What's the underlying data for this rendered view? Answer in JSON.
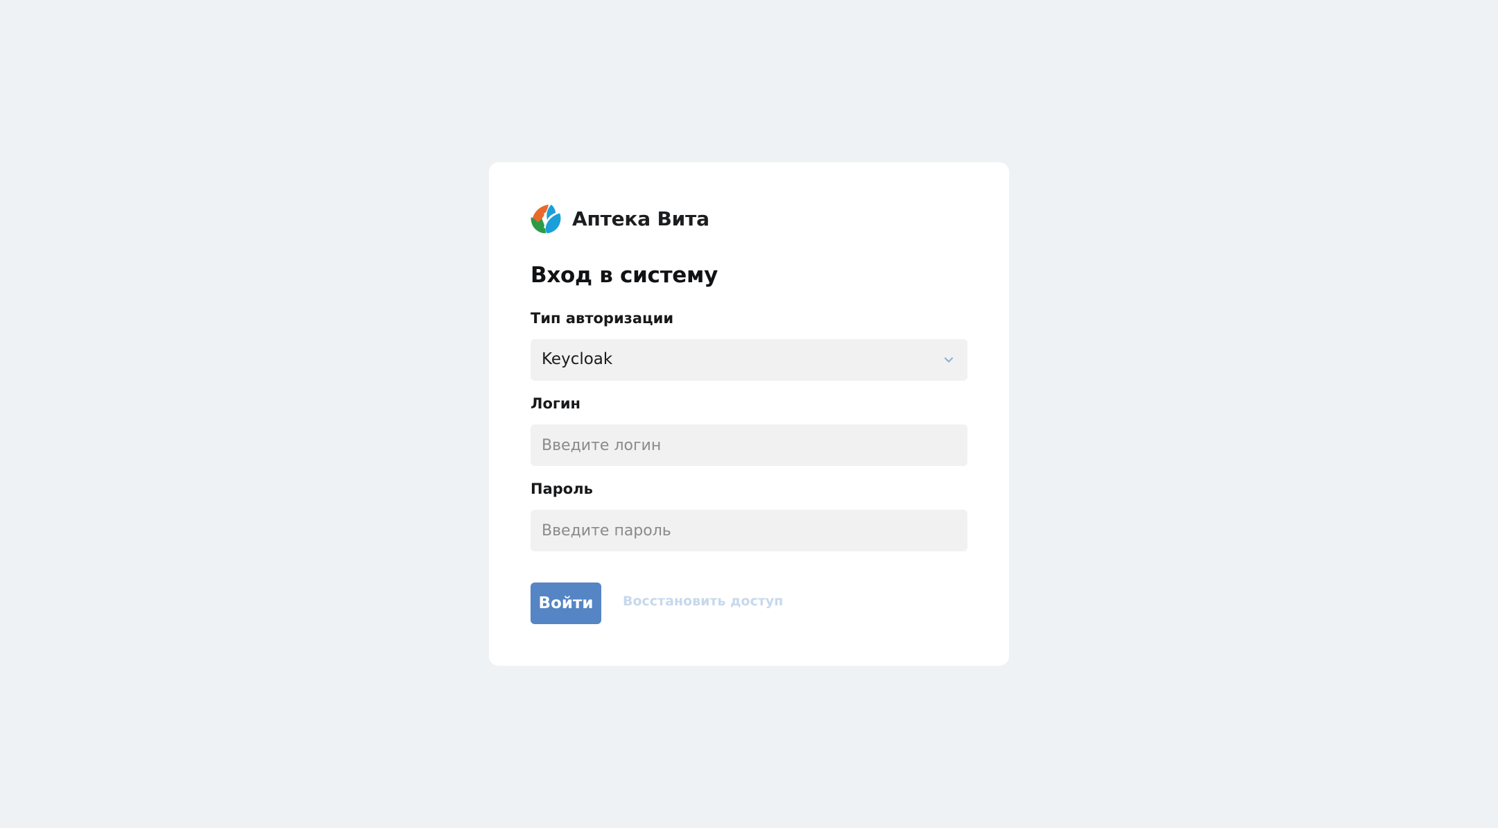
{
  "brand": {
    "name": "Аптека Вита",
    "logo_icon": "leaf-globe-logo",
    "logo_colors": [
      "#e8692c",
      "#2e9a48",
      "#1b9fd9"
    ]
  },
  "login_form": {
    "title": "Вход в систему",
    "auth_type": {
      "label": "Тип авторизации",
      "selected_value": "Keycloak",
      "icon": "chevron-down-icon"
    },
    "login": {
      "label": "Логин",
      "value": "",
      "placeholder": "Введите логин"
    },
    "password": {
      "label": "Пароль",
      "value": "",
      "placeholder": "Введите пароль"
    },
    "submit_label": "Войти",
    "restore_label": "Восстановить доступ"
  },
  "colors": {
    "page_background": "#eff2f5",
    "card_background": "#ffffff",
    "field_background": "#f1f1f1",
    "primary_button": "#5585c4",
    "restore_link": "#c7d8ec",
    "chevron": "#8fb0d6"
  }
}
